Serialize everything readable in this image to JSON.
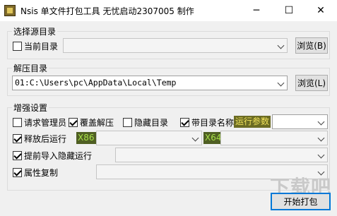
{
  "window": {
    "title": "Nsis 单文件打包工具 无忧启动2307005 制作",
    "minimize_glyph": "─",
    "maximize_glyph": "☐",
    "close_glyph": "✕"
  },
  "source_group": {
    "title": "选择源目录",
    "current_dir_label": "当前目录",
    "current_dir_checked": false,
    "path_value": "",
    "browse_label": "浏览(B)"
  },
  "extract_group": {
    "title": "解压目录",
    "path_value": "01:C:\\Users\\pc\\AppData\\Local\\Temp",
    "browse_label": "浏览(L)"
  },
  "enhance_group": {
    "title": "增强设置",
    "options": {
      "admin": {
        "label": "请求管理员",
        "checked": false
      },
      "overwrite": {
        "label": "覆盖解压",
        "checked": true
      },
      "hide_dir": {
        "label": "隐藏目录",
        "checked": false
      },
      "with_dir_name": {
        "label": "带目录名称",
        "checked": true
      },
      "run_after": {
        "label": "释放后运行",
        "checked": true
      },
      "preload": {
        "label": "提前导入隐藏运行",
        "checked": true
      },
      "copy_attr": {
        "label": "属性复制",
        "checked": true
      }
    },
    "run_params_tag": "运行参数",
    "run_params_value": "",
    "x86_tag": "X86",
    "x86_value": "",
    "x64_tag": "X64",
    "x64_value": "",
    "preload_value": "",
    "copy_attr_value": ""
  },
  "footer": {
    "pack_button": "开始打包",
    "watermark": "下载吧"
  }
}
